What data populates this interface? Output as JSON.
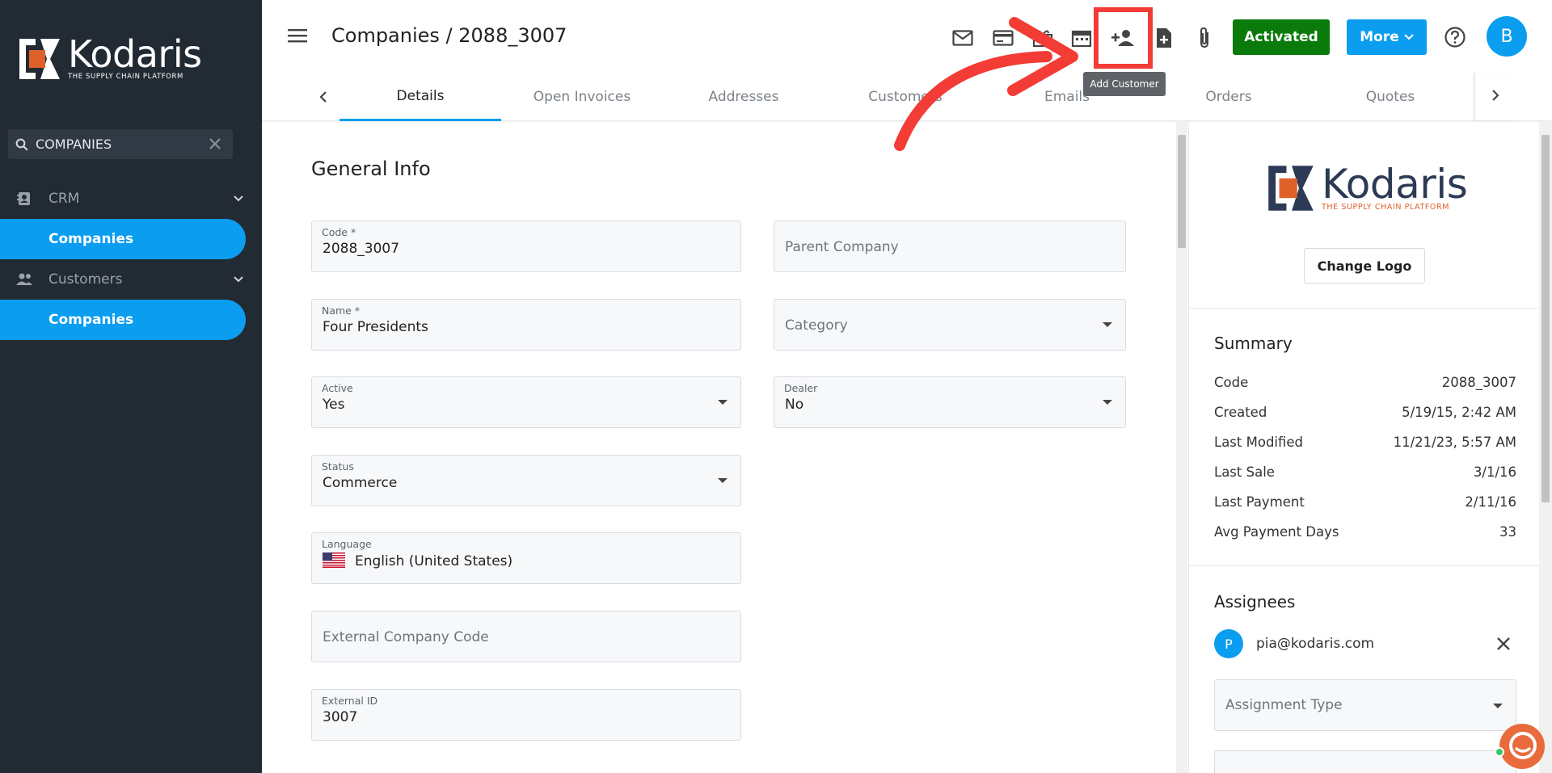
{
  "brand": {
    "name": "Kodaris",
    "tagline": "THE SUPPLY CHAIN PLATFORM",
    "colors": {
      "dark": "#222a33",
      "accent": "#0a9df0",
      "orange": "#e0602a",
      "navy": "#2d3a55"
    }
  },
  "sidebar": {
    "search_value": "COMPANIES",
    "groups": [
      {
        "label": "CRM",
        "icon": "contact-card-icon",
        "item": "Companies"
      },
      {
        "label": "Customers",
        "icon": "people-icon",
        "item": "Companies"
      }
    ]
  },
  "header": {
    "title": "Companies / 2088_3007",
    "toolbar_icons": [
      "mail-icon",
      "credit-card-icon",
      "gift-icon",
      "calendar-icon",
      "add-customer-icon",
      "add-document-icon",
      "attachment-icon"
    ],
    "activated_label": "Activated",
    "more_label": "More",
    "avatar_initial": "B",
    "tooltip": "Add Customer"
  },
  "tabs": [
    "Details",
    "Open Invoices",
    "Addresses",
    "Customers",
    "Emails",
    "Orders",
    "Quotes"
  ],
  "form": {
    "section_title": "General Info",
    "code": {
      "label": "Code *",
      "value": "2088_3007"
    },
    "parent_company": {
      "placeholder": "Parent Company"
    },
    "name": {
      "label": "Name *",
      "value": "Four Presidents"
    },
    "category": {
      "placeholder": "Category"
    },
    "active": {
      "label": "Active",
      "value": "Yes"
    },
    "dealer": {
      "label": "Dealer",
      "value": "No"
    },
    "status": {
      "label": "Status",
      "value": "Commerce"
    },
    "language": {
      "label": "Language",
      "value": "English (United States)"
    },
    "external_company_code": {
      "placeholder": "External Company Code"
    },
    "external_id": {
      "label": "External ID",
      "value": "3007"
    }
  },
  "right_panel": {
    "change_logo_label": "Change Logo",
    "summary": {
      "title": "Summary",
      "rows": [
        {
          "label": "Code",
          "value": "2088_3007"
        },
        {
          "label": "Created",
          "value": "5/19/15, 2:42 AM"
        },
        {
          "label": "Last Modified",
          "value": "11/21/23, 5:57 AM"
        },
        {
          "label": "Last Sale",
          "value": "3/1/16"
        },
        {
          "label": "Last Payment",
          "value": "2/11/16"
        },
        {
          "label": "Avg Payment Days",
          "value": "33"
        }
      ]
    },
    "assignees": {
      "title": "Assignees",
      "entries": [
        {
          "initial": "P",
          "email": "pia@kodaris.com"
        }
      ],
      "assignment_type_placeholder": "Assignment Type"
    }
  }
}
